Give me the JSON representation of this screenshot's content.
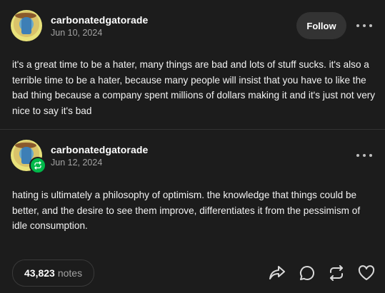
{
  "original_post": {
    "username": "carbonatedgatorade",
    "date": "Jun 10, 2024",
    "follow_label": "Follow",
    "text": "it's a great time to be a hater, many things are bad and lots of stuff sucks. it's also a terrible time to be a hater, because many people will insist that you have to like the bad thing because a company spent millions of dollars making it and it's just not very nice to say it's bad"
  },
  "reblog": {
    "username": "carbonatedgatorade",
    "date": "Jun 12, 2024",
    "text": "hating is ultimately a philosophy of optimism. the knowledge that things could be better, and the desire to see them improve, differentiates it from the pessimism of idle consumption."
  },
  "footer": {
    "notes_count": "43,823",
    "notes_label": "notes",
    "actions": [
      "share-icon",
      "reply-icon",
      "reblog-icon",
      "like-icon"
    ]
  },
  "colors": {
    "background": "#1c1c1c",
    "muted_text": "#a3a3a3",
    "reblog_badge": "#00b84a"
  }
}
